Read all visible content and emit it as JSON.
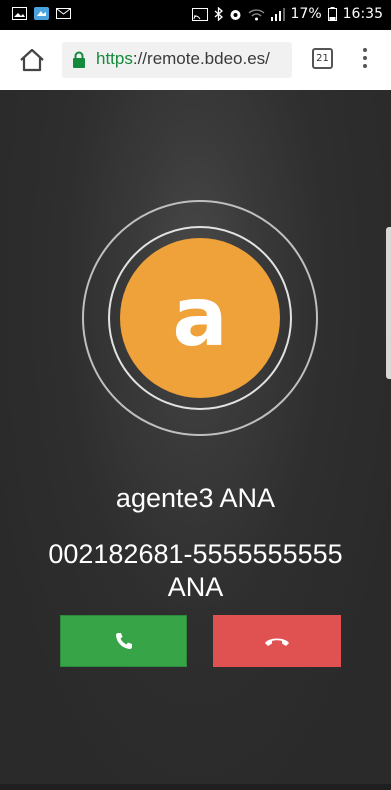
{
  "status_bar": {
    "signal_text": "",
    "battery": "17%",
    "time": "16:35",
    "icons": [
      "gallery-icon",
      "cloud-icon",
      "mail-icon",
      "cast-icon",
      "bluetooth-icon",
      "alarm-icon",
      "wifi-icon",
      "signal-icon",
      "battery-icon"
    ]
  },
  "browser": {
    "url_scheme": "https",
    "url_rest": "://remote.bdeo.es/",
    "tab_count": "21"
  },
  "call": {
    "avatar_letter": "a",
    "agent_name": "agente3 ANA",
    "phone_number": "002182681-5555555555",
    "caller_label": "ANA",
    "accept_icon": "phone-icon",
    "reject_icon": "hangup-icon"
  },
  "colors": {
    "avatar": "#efa13a",
    "accept": "#36a447",
    "reject": "#e05252",
    "https_green": "#168a3b"
  }
}
